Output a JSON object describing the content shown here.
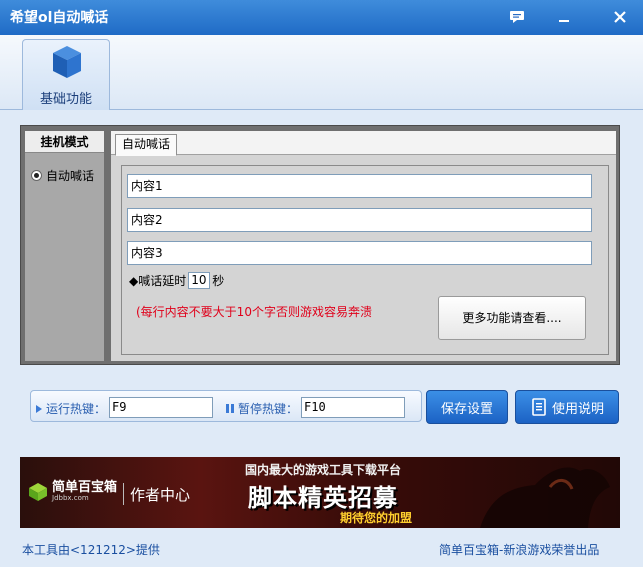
{
  "window": {
    "title": "希望ol自动喊话"
  },
  "toolbar": {
    "basic_label": "基础功能"
  },
  "left_panel": {
    "header": "挂机模式",
    "mode_item": "自动喊话"
  },
  "tabs": {
    "active": "自动喊话"
  },
  "form": {
    "content1": "内容1",
    "content2": "内容2",
    "content3": "内容3",
    "delay_prefix": "◆喊话延时",
    "delay_value": "10",
    "delay_unit": "秒",
    "warning": "(每行内容不要大于10个字否则游戏容易奔溃",
    "more_button": "更多功能请查看...."
  },
  "hotkeys": {
    "run_label": "运行热键：",
    "run_value": "F9",
    "pause_label": "暂停热键：",
    "pause_value": "F10"
  },
  "buttons": {
    "save": "保存设置",
    "help": "使用说明"
  },
  "banner": {
    "brand": "简单百宝箱",
    "domain": "Jdbbx.com",
    "author": "作者中心",
    "slogan": "国内最大的游戏工具下载平台",
    "headline": "脚本精英招募",
    "subline": "期待您的加盟"
  },
  "footer": {
    "left": "本工具由<121212>提供",
    "right": "简单百宝箱-新浪游戏荣誉出品"
  },
  "colors": {
    "accent": "#1f6bc6",
    "warning": "#e0001a",
    "link": "#1a4fa0"
  }
}
